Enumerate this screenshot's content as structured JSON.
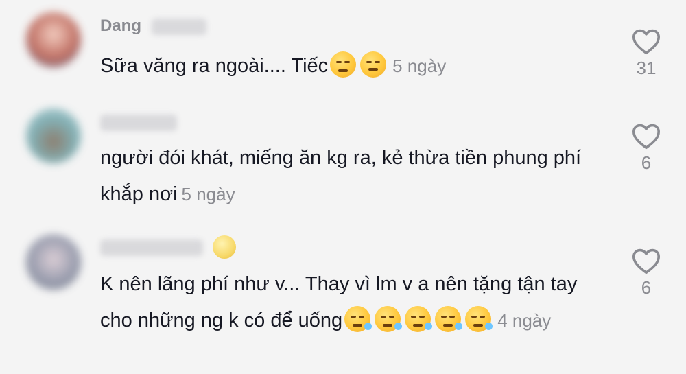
{
  "comments": [
    {
      "username": "Dang",
      "text": "Sữa văng ra ngoài.... Tiếc",
      "time": "5 ngày",
      "likes": "31",
      "avatar_color": "#b85a4c",
      "emojis": [
        "relieved-face-emoji",
        "disappointed-face-emoji"
      ]
    },
    {
      "username": "",
      "text": "người đói khát, miếng ăn kg ra, kẻ thừa tiền phung phí khắp nơi",
      "time": "5 ngày",
      "likes": "6",
      "avatar_color": "#6fa3a8"
    },
    {
      "username": "",
      "text": "K nên lãng phí như v... Thay vì lm v a nên tặng tận tay cho những ng k có để uống",
      "time": "4 ngày",
      "likes": "6",
      "avatar_color": "#8b8fa3",
      "emojis": [
        "sleepy-face-emoji",
        "sleepy-face-emoji",
        "sleepy-face-emoji",
        "sleepy-face-emoji",
        "sleepy-face-emoji"
      ]
    }
  ],
  "icons": {
    "like": "heart-outline-icon"
  },
  "colors": {
    "background": "#f4f4f4",
    "text": "#161823",
    "muted": "#8a8b91"
  }
}
